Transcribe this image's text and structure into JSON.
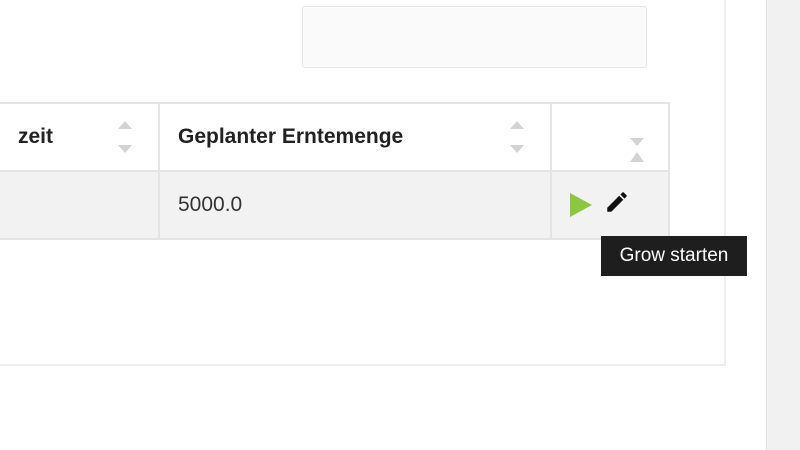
{
  "table": {
    "headers": {
      "col1": "zeit",
      "col2": "Geplanter Erntemenge"
    },
    "rows": [
      {
        "col1": "",
        "col2": "5000.0"
      }
    ]
  },
  "actions": {
    "play_icon": "play-icon",
    "edit_icon": "pencil-icon",
    "play_color": "#8dc63f"
  },
  "tooltip": {
    "text": "Grow starten"
  }
}
